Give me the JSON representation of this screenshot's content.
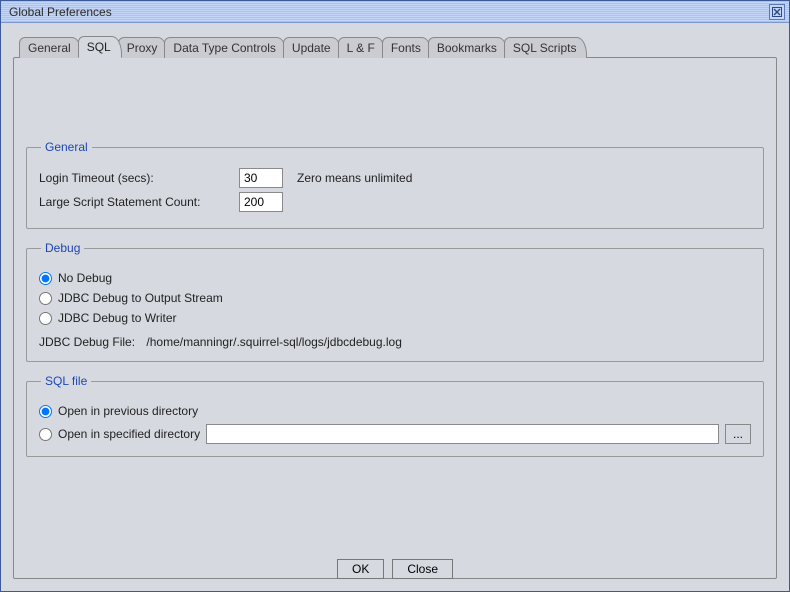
{
  "window": {
    "title": "Global Preferences"
  },
  "tabs": [
    {
      "label": "General"
    },
    {
      "label": "SQL"
    },
    {
      "label": "Proxy"
    },
    {
      "label": "Data Type Controls"
    },
    {
      "label": "Update"
    },
    {
      "label": "L & F"
    },
    {
      "label": "Fonts"
    },
    {
      "label": "Bookmarks"
    },
    {
      "label": "SQL Scripts"
    }
  ],
  "active_tab_index": 1,
  "general": {
    "legend": "General",
    "login_timeout_label": "Login Timeout (secs):",
    "login_timeout_value": "30",
    "login_timeout_help": "Zero means unlimited",
    "large_script_label": "Large Script Statement Count:",
    "large_script_value": "200"
  },
  "debug": {
    "legend": "Debug",
    "options": [
      {
        "label": "No Debug",
        "selected": true
      },
      {
        "label": "JDBC Debug to Output Stream",
        "selected": false
      },
      {
        "label": "JDBC Debug to Writer",
        "selected": false
      }
    ],
    "file_label": "JDBC Debug File:",
    "file_value": "/home/manningr/.squirrel-sql/logs/jdbcdebug.log"
  },
  "sqlfile": {
    "legend": "SQL file",
    "options": [
      {
        "label": "Open in previous directory",
        "selected": true
      },
      {
        "label": "Open in specified directory",
        "selected": false
      }
    ],
    "dir_value": "",
    "browse_label": "..."
  },
  "buttons": {
    "ok": "OK",
    "close": "Close"
  }
}
